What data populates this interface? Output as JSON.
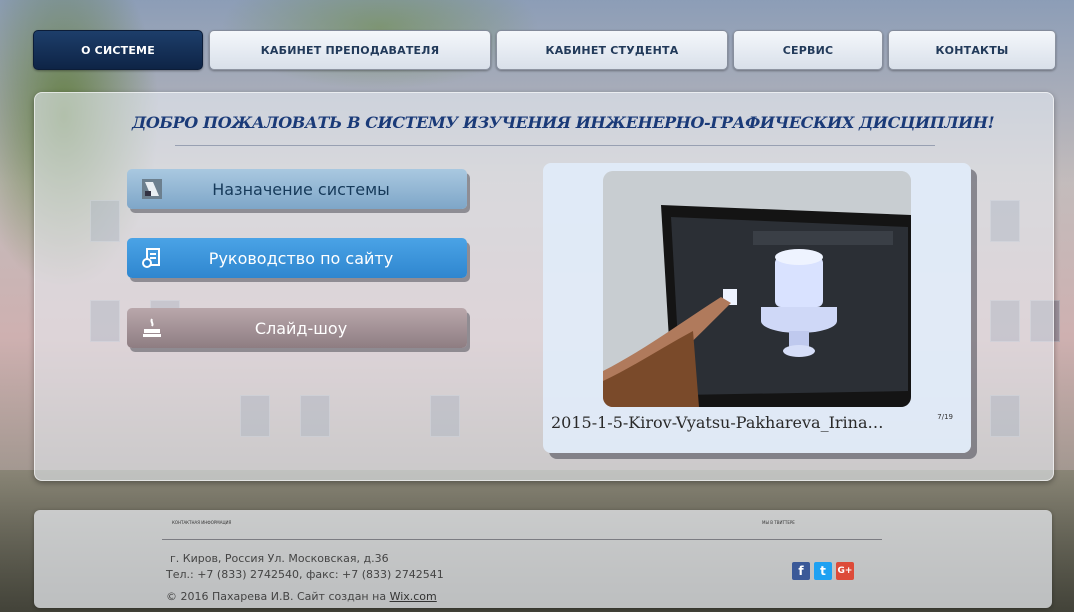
{
  "nav": {
    "items": [
      {
        "label": "О СИСТЕМЕ",
        "active": true
      },
      {
        "label": "КАБИНЕТ ПРЕПОДАВАТЕЛЯ",
        "active": false
      },
      {
        "label": "КАБИНЕТ СТУДЕНТА",
        "active": false
      },
      {
        "label": "СЕРВИС",
        "active": false
      },
      {
        "label": "КОНТАКТЫ",
        "active": false
      }
    ]
  },
  "main": {
    "welcome": "ДОБРО ПОЖАЛОВАТЬ  В СИСТЕМУ ИЗУЧЕНИЯ ИНЖЕНЕРНО-ГРАФИЧЕСКИХ ДИСЦИПЛИН!",
    "buttons": [
      {
        "label": "Назначение системы",
        "icon": "tool-icon"
      },
      {
        "label": "Руководство по сайту",
        "icon": "document-icon"
      },
      {
        "label": "Слайд-шоу",
        "icon": "slideshow-icon"
      }
    ],
    "slideshow": {
      "caption": "2015-1-5-Kirov-Vyatsu-Pakhareva_Irina…",
      "counter": "7/19"
    }
  },
  "footer": {
    "contact_heading": "КОНТАКТНАЯ ИНФОРМАЦИЯ",
    "social_heading": "МЫ В ТВИТТЕРЕ",
    "address": "г. Киров, Россия  Ул. Московская, д.36",
    "phone": "Тел.:  +7 (833) 2742540, факс: +7 (833) 2742541",
    "copyright": "© 2016 Пахарева И.В. Сайт создан на ",
    "wix_link": "Wix.com",
    "social": [
      {
        "name": "facebook-icon",
        "glyph": "f",
        "color": "#3b5998"
      },
      {
        "name": "twitter-icon",
        "glyph": "t",
        "color": "#1da1f2"
      },
      {
        "name": "google-plus-icon",
        "glyph": "G+",
        "color": "#dd4b39"
      }
    ]
  },
  "colors": {
    "nav_active": "#142f57",
    "accent_blue": "#3a93da",
    "title_blue": "#1a3a78"
  }
}
